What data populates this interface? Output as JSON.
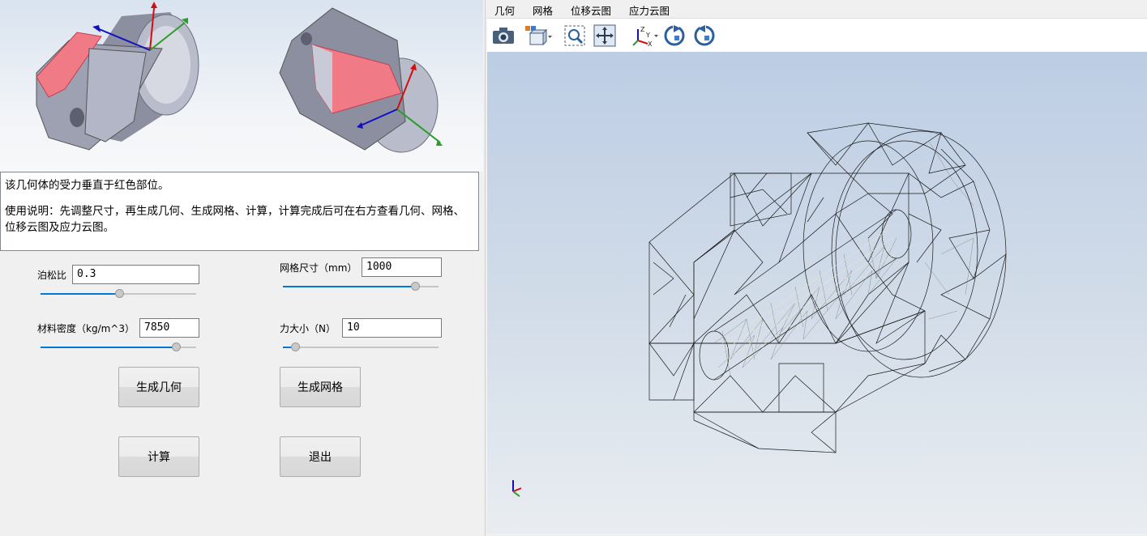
{
  "description": {
    "line1": "该几何体的受力垂直于红色部位。",
    "line2": "使用说明：先调整尺寸，再生成几何、生成网格、计算，计算完成后可在右方查看几何、网格、位移云图及应力云图。"
  },
  "params": {
    "poisson": {
      "label": "泊松比",
      "value": "0.3",
      "slider_fraction": 0.52
    },
    "mesh_size": {
      "label": "网格尺寸（mm）",
      "value": "1000",
      "slider_fraction": 0.85
    },
    "density": {
      "label": "材料密度（kg/m^3）",
      "value": "7850",
      "slider_fraction": 0.86
    },
    "force": {
      "label": "力大小（N）",
      "value": "10",
      "slider_fraction": 0.08
    }
  },
  "buttons": {
    "gen_geometry": "生成几何",
    "gen_mesh": "生成网格",
    "compute": "计算",
    "exit": "退出"
  },
  "tabs": [
    "几何",
    "网格",
    "位移云图",
    "应力云图"
  ],
  "toolbar_icons": [
    "camera-icon",
    "view-cube-icon",
    "zoom-box-icon",
    "pan-icon",
    "axes-orientation-icon",
    "rotate-cw-icon",
    "rotate-ccw-icon"
  ],
  "colors": {
    "accent": "#0078d7",
    "highlight_face": "#f07a86",
    "x_axis": "#2a9d2a",
    "y_axis": "#d01010",
    "z_axis": "#1010c0"
  }
}
